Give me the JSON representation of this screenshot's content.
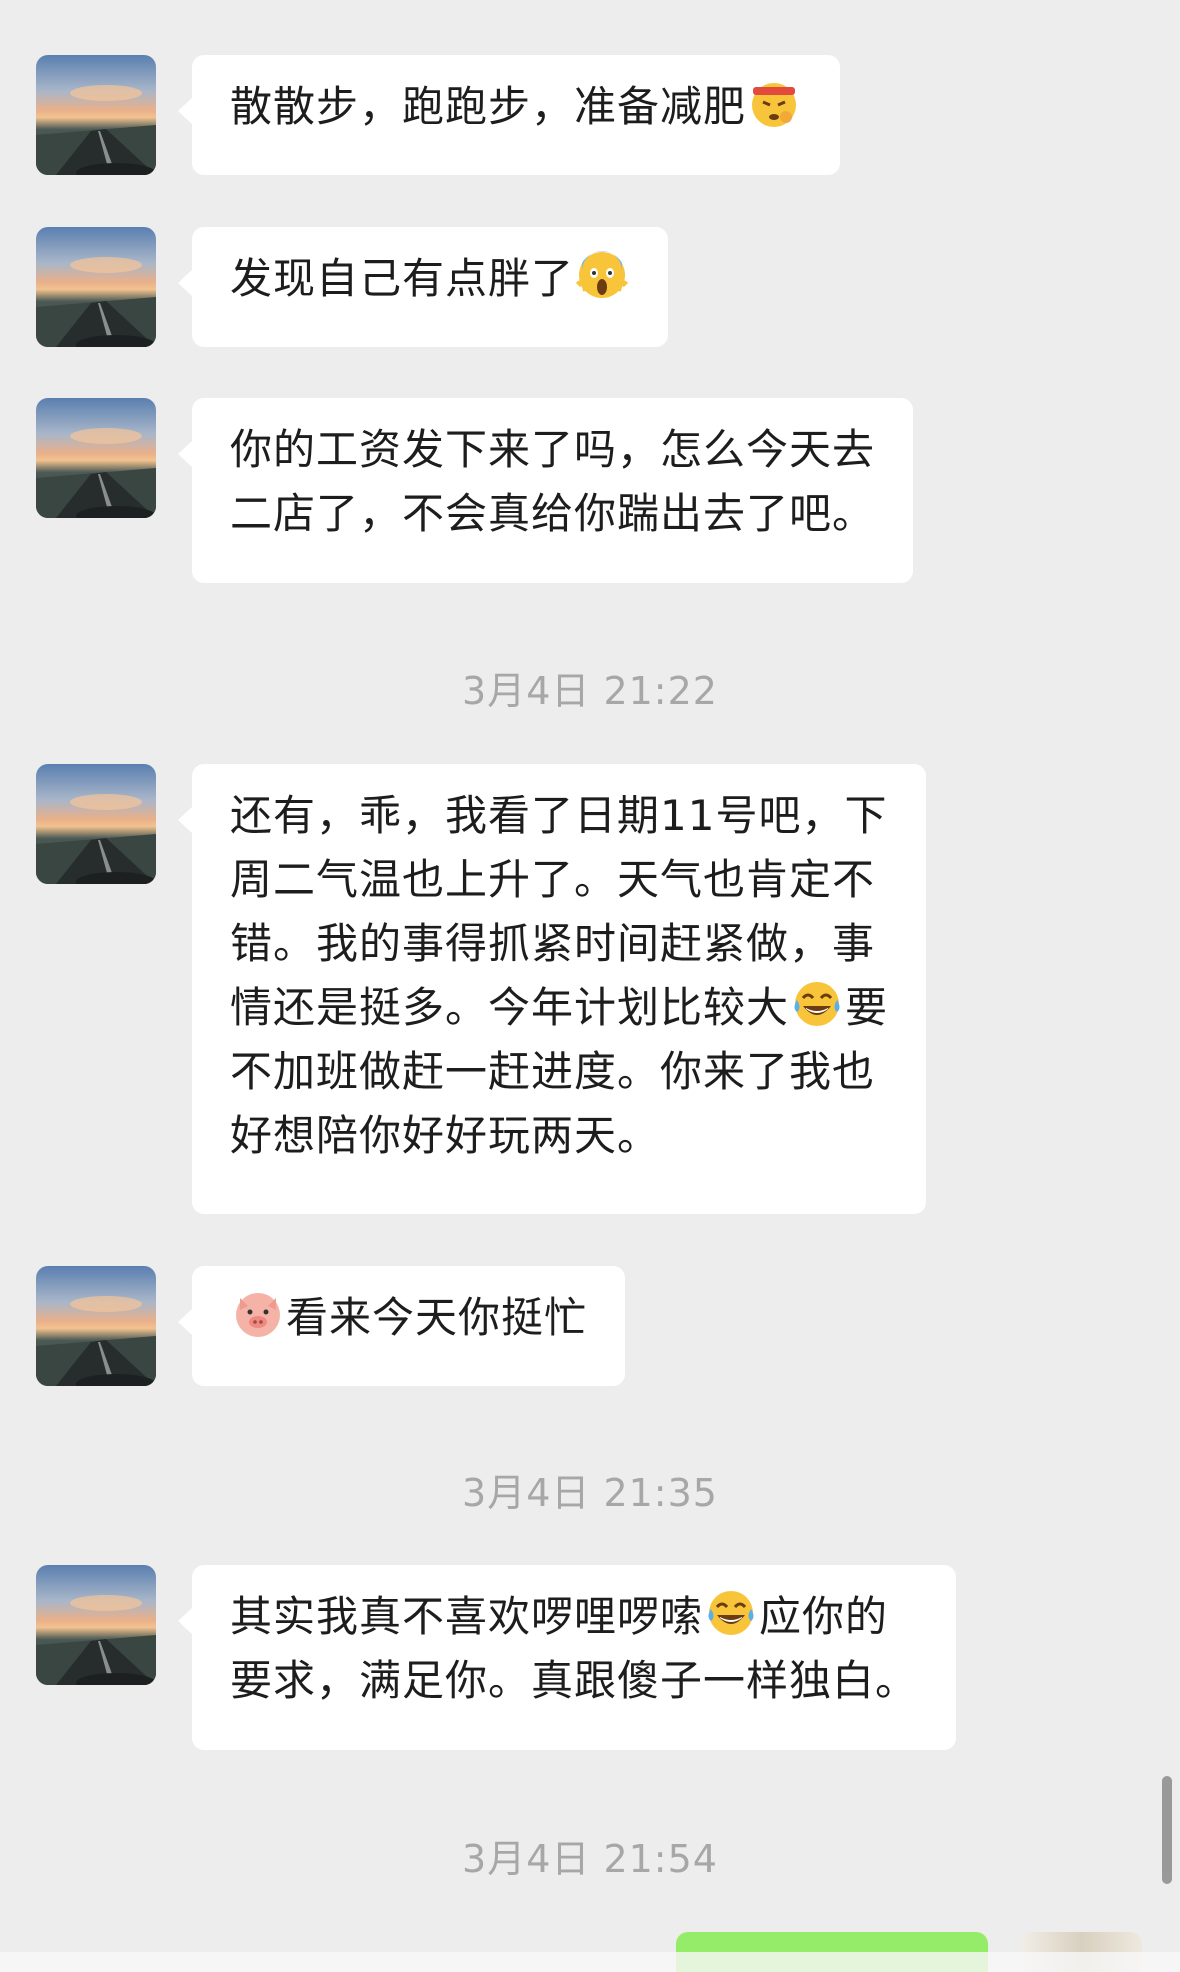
{
  "chat": {
    "messages": [
      {
        "type": "incoming",
        "text": "散散步，跑跑步，准备减肥",
        "emoji": "headband-determined-emoji"
      },
      {
        "type": "incoming",
        "text": "发现自己有点胖了",
        "emoji": "screaming-fear-emoji"
      },
      {
        "type": "incoming",
        "text": "你的工资发下来了吗，怎么今天去\n二店了，不会真给你踹出去了吧。"
      },
      {
        "type": "timestamp",
        "text": "3月4日 21:22"
      },
      {
        "type": "incoming",
        "text_part1": "还有，乖，我看了日期11号吧，下\n周二气温也上升了。天气也肯定不\n错。我的事得抓紧时间赶紧做，事\n情还是挺多。今年计划比较大",
        "emoji": "tears-of-joy-emoji",
        "text_part2": "要\n不加班做赶一赶进度。你来了我也\n好想陪你好好玩两天。"
      },
      {
        "type": "incoming",
        "emoji": "pig-face-emoji",
        "text": "看来今天你挺忙"
      },
      {
        "type": "timestamp",
        "text": "3月4日 21:35"
      },
      {
        "type": "incoming",
        "text_part1": "其实我真不喜欢啰哩啰嗦",
        "emoji": "tears-of-joy-emoji",
        "text_part2": "应你的\n要求，满足你。真跟傻子一样独白。"
      },
      {
        "type": "timestamp",
        "text": "3月4日 21:54"
      }
    ]
  },
  "colors": {
    "background": "#ededed",
    "incoming_bubble": "#ffffff",
    "outgoing_bubble": "#95ec69",
    "timestamp_text": "#a7a7a7"
  }
}
